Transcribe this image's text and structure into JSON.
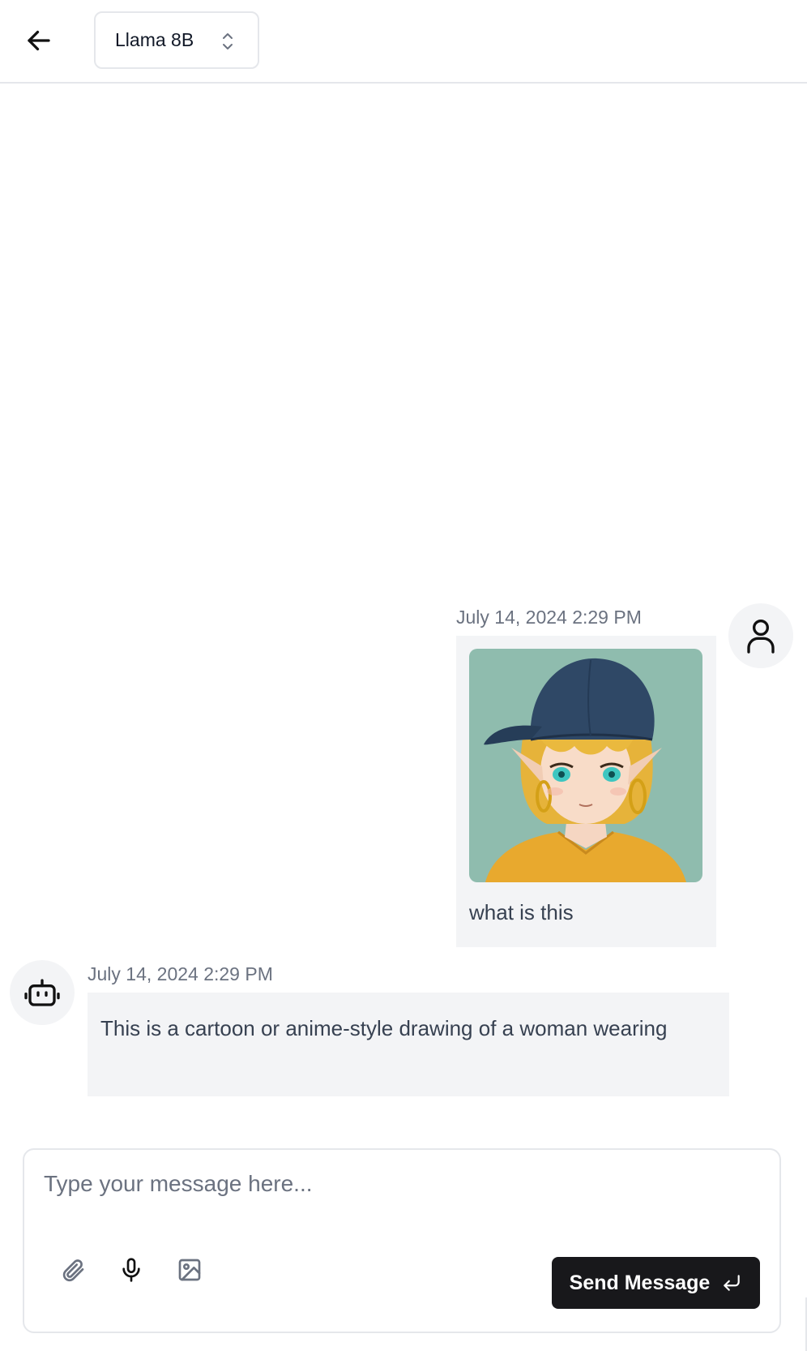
{
  "header": {
    "back_icon": "arrow-left-icon",
    "model_label": "Llama 8B",
    "model_icon": "chevron-up-down-icon"
  },
  "messages": [
    {
      "role": "user",
      "timestamp": "July 14, 2024 2:29 PM",
      "image_desc": "anime girl with blue cap",
      "text": "what is this",
      "avatar_icon": "user-icon"
    },
    {
      "role": "assistant",
      "timestamp": "July 14, 2024 2:29 PM",
      "text": "This is a cartoon or anime-style drawing of a woman wearing",
      "avatar_icon": "bot-icon"
    }
  ],
  "composer": {
    "placeholder": "Type your message here...",
    "value": "",
    "attach_icon": "paperclip-icon",
    "mic_icon": "microphone-icon",
    "image_icon": "image-icon",
    "send_label": "Send Message",
    "send_icon": "enter-return-icon"
  },
  "colors": {
    "send_bg": "#18181b",
    "bubble_bg": "#f3f4f6",
    "border": "#e5e7eb",
    "muted_text": "#6b7280"
  }
}
